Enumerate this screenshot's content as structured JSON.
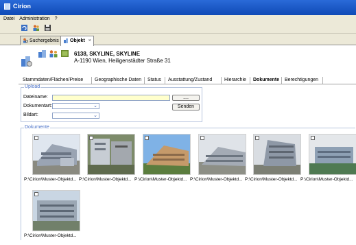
{
  "app": {
    "title": "Cirion",
    "colors": {
      "titlebar": "#0f4ab6",
      "field_highlight": "#ffffcc",
      "legend": "#4a71c7"
    }
  },
  "menu": [
    "Datei",
    "Administration",
    "?"
  ],
  "toolbar": {
    "icons": [
      "refresh-icon",
      "users-icon",
      "save-icon"
    ]
  },
  "tabs": [
    {
      "label": "Suchergebnis",
      "icon": "search-users-icon"
    },
    {
      "label": "Objekt",
      "icon": "object-icon",
      "active": true,
      "close": "×"
    }
  ],
  "object": {
    "name": "6138, SKYLINE, SKYLINE",
    "address": "A-1190 Wien, Heiligenstädter Straße 31"
  },
  "subtabs": [
    {
      "label": "Stammdaten/Flächen/Preise"
    },
    {
      "label": "Geographische Daten"
    },
    {
      "label": "Status"
    },
    {
      "label": "Ausstattung/Zustand"
    },
    {
      "label": "Hierarchie"
    },
    {
      "label": "Dokumente",
      "active": true
    },
    {
      "label": "Berechtigungen"
    }
  ],
  "upload": {
    "legend": "Upload",
    "dateiname_label": "Dateiname:",
    "dateiname_value": "",
    "browse_label": "....",
    "dokumentart_label": "Dokumentart:",
    "dokumentart_value": "",
    "bildart_label": "Bildart:",
    "bildart_value": "",
    "send_label": "Senden"
  },
  "documents": {
    "legend": "Dokumente",
    "items": [
      {
        "caption": "P:\\Cirion\\Muster-Objektd..."
      },
      {
        "caption": "P:\\Cirion\\Muster-Objektd..."
      },
      {
        "caption": "P:\\Cirion\\Muster-Objektd..."
      },
      {
        "caption": "P:\\Cirion\\Muster-Objektd..."
      },
      {
        "caption": "P:\\Cirion\\Muster-Objektd..."
      },
      {
        "caption": "P:\\Cirion\\Muster-Objektd..."
      },
      {
        "caption": "P:\\Cirion\\Muster-Objektd..."
      }
    ]
  }
}
